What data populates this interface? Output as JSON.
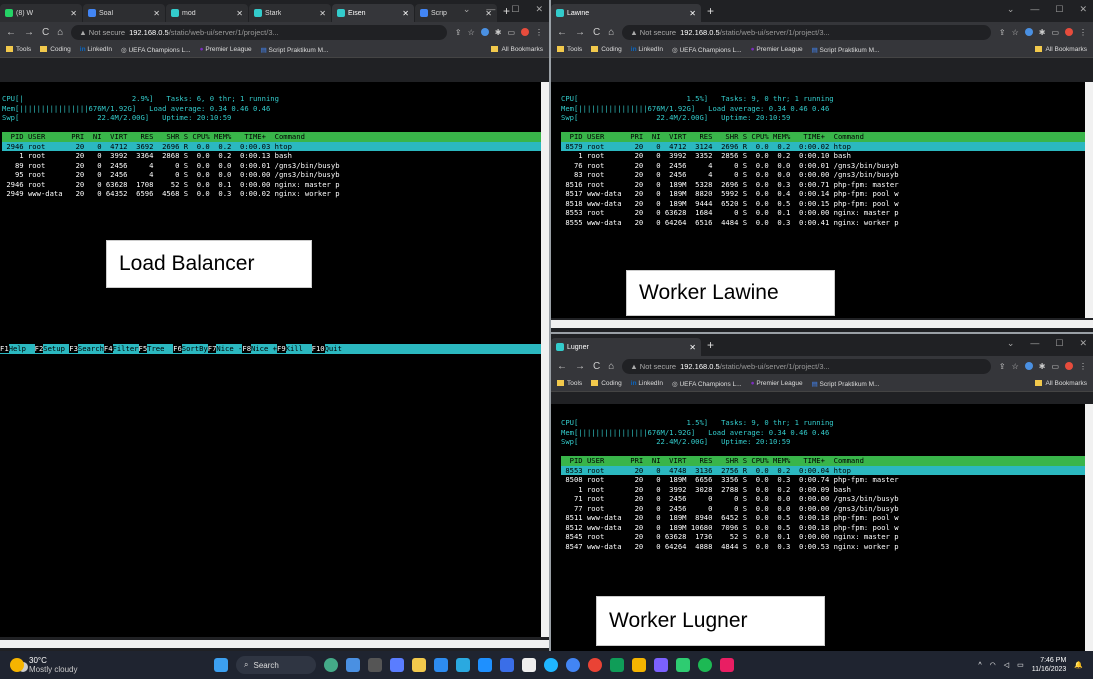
{
  "left_window": {
    "tabs": [
      {
        "label": "(8) W",
        "icon": "whatsapp-icon",
        "color": "#25d366"
      },
      {
        "label": "Soal",
        "icon": "docs-icon",
        "color": "#4285f4"
      },
      {
        "label": "mod",
        "icon": "web-icon",
        "color": "#3cc"
      },
      {
        "label": "Stark",
        "icon": "web-icon",
        "color": "#3cc"
      },
      {
        "label": "Eisen",
        "icon": "web-icon",
        "color": "#3cc",
        "active": true
      },
      {
        "label": "Scrip",
        "icon": "docs-icon",
        "color": "#4285f4"
      }
    ]
  },
  "lawine_window": {
    "tab_label": "Lawine"
  },
  "lugner_window": {
    "tab_label": "Lugner"
  },
  "address": {
    "not_secure": "Not secure",
    "host": "192.168.0.5",
    "path": "/static/web-ui/server/1/project/3..."
  },
  "bookmarks": {
    "items": [
      "Tools",
      "Coding",
      "LinkedIn",
      "UEFA Champions L...",
      "Premier League",
      "Script Praktikum M..."
    ],
    "all": "All Bookmarks"
  },
  "htop_lb": {
    "header": [
      "CPU[|                         2.9%]   Tasks: 6, 0 thr; 1 running",
      "Mem[||||||||||||||||676M/1.92G]   Load average: 0.34 0.46 0.46",
      "Swp[                  22.4M/2.00G]   Uptime: 20:10:59"
    ],
    "columns": "  PID USER      PRI  NI  VIRT   RES   SHR S CPU% MEM%   TIME+  Command",
    "selected": " 2946 root       20   0  4712  3692  2696 R  0.0  0.2  0:00.03 htop",
    "rows": [
      "    1 root       20   0  3992  3364  2868 S  0.0  0.2  0:00.13 bash",
      "   89 root       20   0  2456     4     0 S  0.0  0.0  0:00.01 /gns3/bin/busyb",
      "   95 root       20   0  2456     4     0 S  0.0  0.0  0:00.00 /gns3/bin/busyb",
      " 2946 root       20   0 63628  1708    52 S  0.0  0.1  0:00.00 nginx: master p",
      " 2949 www-data   20   0 64352  6596  4568 S  0.0  0.3  0:00.02 nginx: worker p"
    ],
    "fkeys": [
      {
        "k": "F1",
        "v": "Help  "
      },
      {
        "k": "F2",
        "v": "Setup "
      },
      {
        "k": "F3",
        "v": "Search"
      },
      {
        "k": "F4",
        "v": "Filter"
      },
      {
        "k": "F5",
        "v": "Tree  "
      },
      {
        "k": "F6",
        "v": "SortBy"
      },
      {
        "k": "F7",
        "v": "Nice -"
      },
      {
        "k": "F8",
        "v": "Nice +"
      },
      {
        "k": "F9",
        "v": "Kill  "
      },
      {
        "k": "F10",
        "v": "Quit  "
      }
    ]
  },
  "htop_lawine": {
    "header": [
      "CPU[                         1.5%]   Tasks: 9, 0 thr; 1 running",
      "Mem[||||||||||||||||676M/1.92G]   Load average: 0.34 0.46 0.46",
      "Swp[                  22.4M/2.00G]   Uptime: 20:10:59"
    ],
    "columns": "  PID USER      PRI  NI  VIRT   RES   SHR S CPU% MEM%   TIME+  Command",
    "selected": " 8579 root       20   0  4712  3124  2696 R  0.0  0.2  0:00.02 htop",
    "rows": [
      "    1 root       20   0  3992  3352  2856 S  0.0  0.2  0:00.10 bash",
      "   76 root       20   0  2456     4     0 S  0.0  0.0  0:00.01 /gns3/bin/busyb",
      "   83 root       20   0  2456     4     0 S  0.0  0.0  0:00.00 /gns3/bin/busyb",
      " 8516 root       20   0  189M  5328  2696 S  0.0  0.3  0:00.71 php-fpm: master",
      " 8517 www-data   20   0  189M  8820  5992 S  0.0  0.4  0:00.14 php-fpm: pool w",
      " 8518 www-data   20   0  189M  9444  6520 S  0.0  0.5  0:00.15 php-fpm: pool w",
      " 8553 root       20   0 63628  1684     0 S  0.0  0.1  0:00.00 nginx: master p",
      " 8555 www-data   20   0 64264  6516  4484 S  0.0  0.3  0:00.41 nginx: worker p"
    ]
  },
  "htop_lugner": {
    "header": [
      "CPU[                         1.5%]   Tasks: 9, 0 thr; 1 running",
      "Mem[||||||||||||||||676M/1.92G]   Load average: 0.34 0.46 0.46",
      "Swp[                  22.4M/2.00G]   Uptime: 20:10:59"
    ],
    "columns": "  PID USER      PRI  NI  VIRT   RES   SHR S CPU% MEM%   TIME+  Command",
    "selected": " 8553 root       20   0  4748  3136  2756 R  0.0  0.2  0:00.04 htop",
    "rows": [
      " 8508 root       20   0  189M  6656  3356 S  0.0  0.3  0:00.74 php-fpm: master",
      "    1 root       20   0  3992  3028  2788 S  0.0  0.2  0:00.09 bash",
      "   71 root       20   0  2456     0     0 S  0.0  0.0  0:00.00 /gns3/bin/busyb",
      "   77 root       20   0  2456     0     0 S  0.0  0.0  0:00.00 /gns3/bin/busyb",
      " 8511 www-data   20   0  189M  8940  6452 S  0.0  0.5  0:00.18 php-fpm: pool w",
      " 8512 www-data   20   0  189M 10680  7096 S  0.0  0.5  0:00.18 php-fpm: pool w",
      " 8545 root       20   0 63628  1736    52 S  0.0  0.1  0:00.00 nginx: master p",
      " 8547 www-data   20   0 64264  4888  4844 S  0.0  0.3  0:00.53 nginx: worker p"
    ]
  },
  "labels": {
    "load_balancer": "Load Balancer",
    "worker_lawine": "Worker Lawine",
    "worker_lugner": "Worker Lugner"
  },
  "taskbar": {
    "temp": "30°C",
    "weather": "Mostly cloudy",
    "search": "Search",
    "time": "7:46 PM",
    "date": "11/16/2023"
  },
  "colors": {
    "htop_header": "#39b54a",
    "htop_selected": "#2bb8c0",
    "chrome_dark": "#202124"
  }
}
